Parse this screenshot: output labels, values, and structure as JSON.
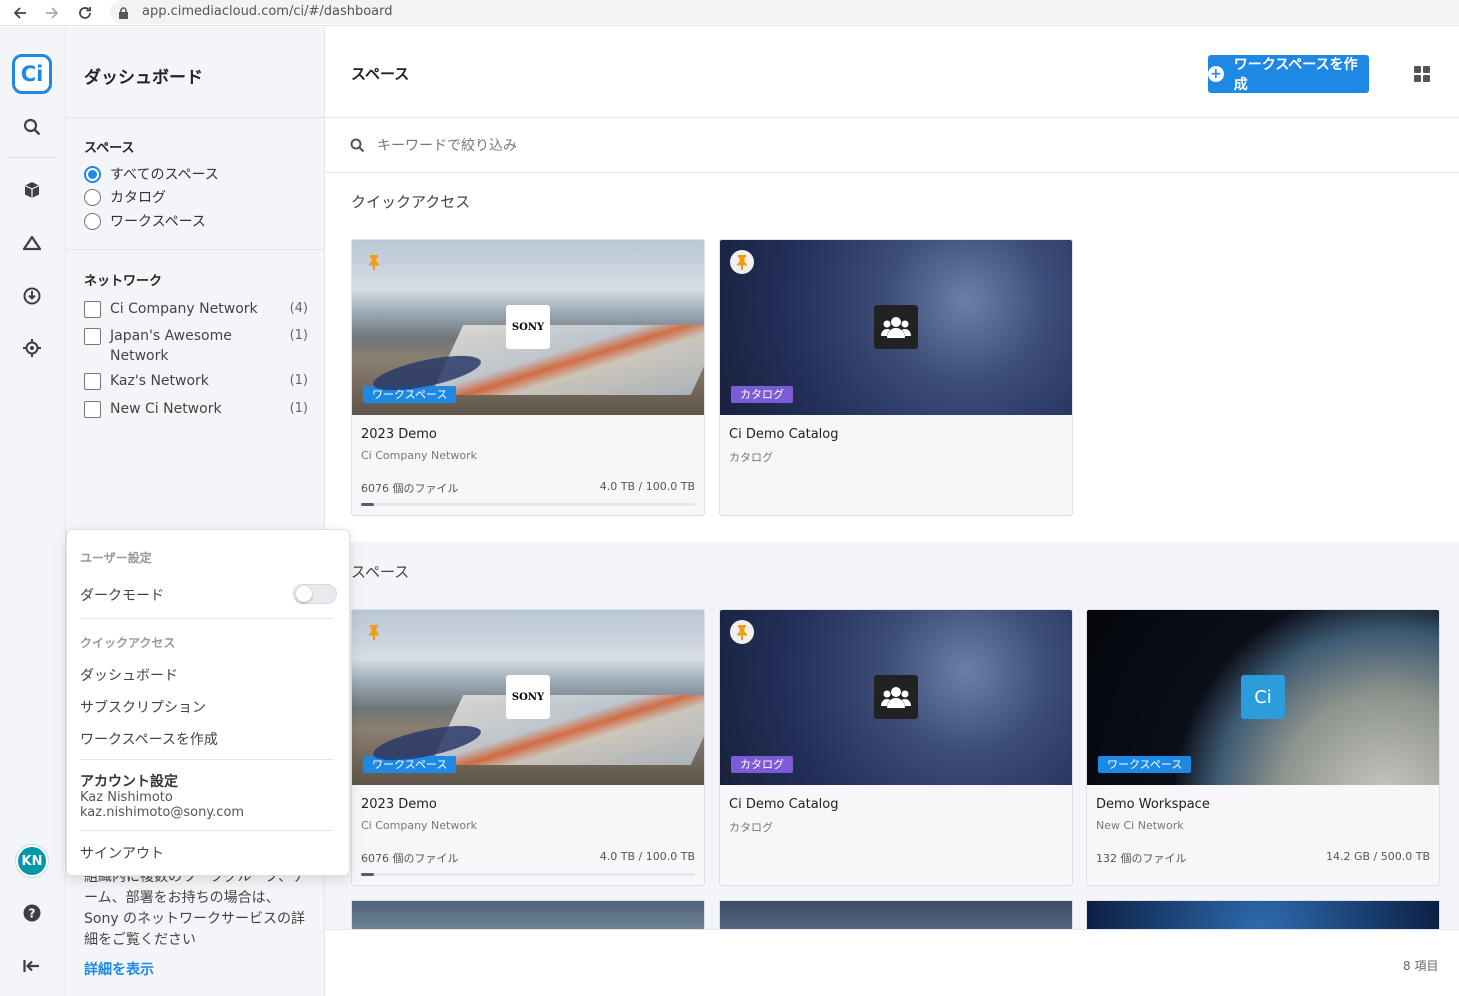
{
  "browser": {
    "url": "app.cimediacloud.com/ci/#/dashboard"
  },
  "rail": {
    "logo": "Ci",
    "avatar": "KN"
  },
  "filters": {
    "title": "ダッシュボード",
    "spaces_heading": "スペース",
    "space_options": [
      {
        "label": "すべてのスペース",
        "selected": true
      },
      {
        "label": "カタログ",
        "selected": false
      },
      {
        "label": "ワークスペース",
        "selected": false
      }
    ],
    "network_heading": "ネットワーク",
    "networks": [
      {
        "label": "Ci Company Network",
        "count": "(4)"
      },
      {
        "label": "Japan's Awesome Network",
        "count": "(1)"
      },
      {
        "label": "Kaz's Network",
        "count": "(1)"
      },
      {
        "label": "New Ci Network",
        "count": "(1)"
      }
    ],
    "info_text": "組織内に複数のワークグループ、チーム、部署をお持ちの場合は、Sony のネットワークサービスの詳細をご覧ください",
    "info_link": "詳細を表示"
  },
  "user_menu": {
    "user_settings": "ユーザー設定",
    "dark_mode": "ダークモード",
    "quick_access": "クイックアクセス",
    "links": [
      "ダッシュボード",
      "サブスクリプション",
      "ワークスペースを作成"
    ],
    "account_settings": "アカウント設定",
    "user_name": "Kaz Nishimoto",
    "user_email": "kaz.nishimoto@sony.com",
    "sign_out": "サインアウト"
  },
  "main": {
    "title": "スペース",
    "create_button": "ワークスペースを作成",
    "search_placeholder": "キーワードで絞り込み",
    "quick_access_heading": "クイックアクセス",
    "spaces_heading": "スペース",
    "item_count": "8 項目"
  },
  "quick_cards": [
    {
      "name": "2023 Demo",
      "sub": "Ci Company Network",
      "badge": "ワークスペース",
      "files": "6076 個のファイル",
      "size": "4.0 TB / 100.0 TB",
      "usage": 0.04,
      "thumb": "beach",
      "logo": "SONY"
    },
    {
      "name": "Ci Demo Catalog",
      "sub": "カタログ",
      "badge": "カタログ",
      "thumb": "space",
      "logo": "team-icon"
    }
  ],
  "space_cards": [
    {
      "name": "2023 Demo",
      "sub": "Ci Company Network",
      "badge": "ワークスペース",
      "files": "6076 個のファイル",
      "size": "4.0 TB / 100.0 TB",
      "usage": 0.04,
      "thumb": "beach",
      "logo": "SONY"
    },
    {
      "name": "Ci Demo Catalog",
      "sub": "カタログ",
      "badge": "カタログ",
      "thumb": "space",
      "logo": "team-icon"
    },
    {
      "name": "Demo Workspace",
      "sub": "New Ci Network",
      "badge": "ワークスペース",
      "files": "132 個のファイル",
      "size": "14.2 GB / 500.0 TB",
      "usage": 0.0,
      "thumb": "earth",
      "logo": "Ci"
    }
  ],
  "colors": {
    "accent": "#1e88e5",
    "catalog": "#7b5cd6",
    "pin": "#f39c12"
  }
}
